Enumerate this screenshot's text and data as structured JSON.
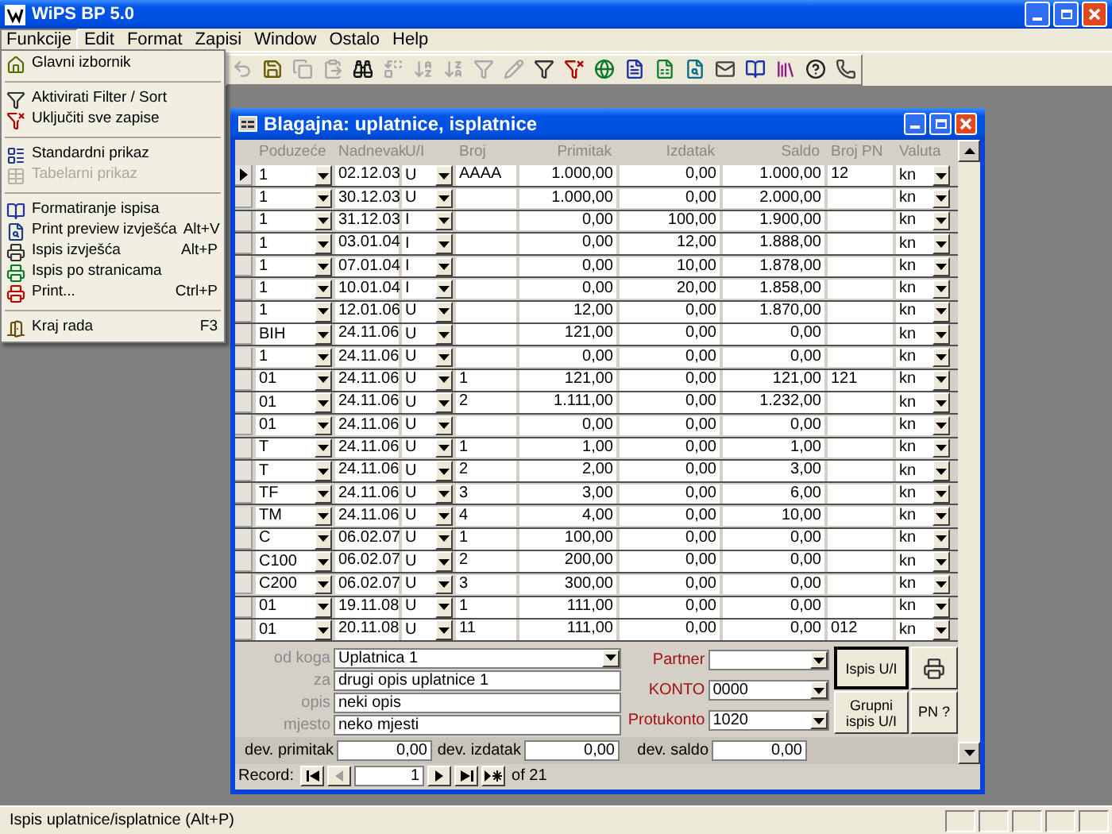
{
  "window": {
    "title": "WiPS BP 5.0"
  },
  "menu_bar": [
    {
      "label": "Funkcije",
      "selected": true
    },
    {
      "label": "Edit",
      "selected": false
    },
    {
      "label": "Format",
      "selected": false
    },
    {
      "label": "Zapisi",
      "selected": false
    },
    {
      "label": "Window",
      "selected": false
    },
    {
      "label": "Ostalo",
      "selected": false
    },
    {
      "label": "Help",
      "selected": false
    }
  ],
  "open_menu": [
    {
      "kind": "item",
      "label": "Glavni izbornik",
      "disabled": false
    },
    {
      "kind": "separator"
    },
    {
      "kind": "item",
      "label": "Aktivirati Filter / Sort",
      "disabled": false
    },
    {
      "kind": "item",
      "label": "Uključiti sve zapise",
      "disabled": false
    },
    {
      "kind": "separator"
    },
    {
      "kind": "item",
      "label": "Standardni prikaz",
      "disabled": false
    },
    {
      "kind": "item",
      "label": "Tabelarni prikaz",
      "disabled": true
    },
    {
      "kind": "separator"
    },
    {
      "kind": "item",
      "label": "Formatiranje ispisa",
      "disabled": false
    },
    {
      "kind": "item",
      "label": "Print preview izvješća",
      "shortcut": "Alt+V",
      "disabled": false
    },
    {
      "kind": "item",
      "label": "Ispis izvješća",
      "shortcut": "Alt+P",
      "disabled": false
    },
    {
      "kind": "item",
      "label": "Ispis po stranicama",
      "disabled": false
    },
    {
      "kind": "item",
      "label": "Print...",
      "shortcut": "Ctrl+P",
      "disabled": false
    },
    {
      "kind": "separator"
    },
    {
      "kind": "item",
      "label": "Kraj rada",
      "shortcut": "F3",
      "disabled": false
    }
  ],
  "toolbar": [
    {
      "disabled": true
    },
    {
      "disabled": false
    },
    {
      "disabled": true
    },
    {
      "disabled": true
    },
    {
      "disabled": false
    },
    {
      "disabled": true
    },
    {
      "disabled": true
    },
    {
      "disabled": true
    },
    {
      "disabled": true
    },
    {
      "disabled": true
    },
    {
      "disabled": false
    },
    {
      "disabled": false
    },
    {
      "disabled": false
    },
    {
      "disabled": false
    },
    {
      "disabled": false
    },
    {
      "disabled": false
    },
    {
      "disabled": false
    },
    {
      "disabled": false
    },
    {
      "disabled": false
    },
    {
      "disabled": false
    },
    {
      "disabled": false
    }
  ],
  "form_window": {
    "title": "Blagajna: uplatnice, isplatnice",
    "columns": [
      "Poduzeće",
      "Nadnevak",
      "U/I",
      "Broj",
      "Primitak",
      "Izdatak",
      "Saldo",
      "Broj PN",
      "Valuta"
    ],
    "rows": [
      {
        "selected": true,
        "cells": [
          "1",
          "02.12.03",
          "U",
          "AAAA",
          "1.000,00",
          "0,00",
          "1.000,00",
          "12",
          "kn"
        ]
      },
      {
        "selected": false,
        "cells": [
          "1",
          "30.12.03",
          "U",
          "",
          "1.000,00",
          "0,00",
          "2.000,00",
          "",
          "kn"
        ]
      },
      {
        "selected": false,
        "cells": [
          "1",
          "31.12.03",
          "I",
          "",
          "0,00",
          "100,00",
          "1.900,00",
          "",
          "kn"
        ]
      },
      {
        "selected": false,
        "cells": [
          "1",
          "03.01.04",
          "I",
          "",
          "0,00",
          "12,00",
          "1.888,00",
          "",
          "kn"
        ]
      },
      {
        "selected": false,
        "cells": [
          "1",
          "07.01.04",
          "I",
          "",
          "0,00",
          "10,00",
          "1.878,00",
          "",
          "kn"
        ]
      },
      {
        "selected": false,
        "cells": [
          "1",
          "10.01.04",
          "I",
          "",
          "0,00",
          "20,00",
          "1.858,00",
          "",
          "kn"
        ]
      },
      {
        "selected": false,
        "cells": [
          "1",
          "12.01.06",
          "U",
          "",
          "12,00",
          "0,00",
          "1.870,00",
          "",
          "kn"
        ]
      },
      {
        "selected": false,
        "cells": [
          "BIH",
          "24.11.06",
          "U",
          "",
          "121,00",
          "0,00",
          "0,00",
          "",
          "kn"
        ]
      },
      {
        "selected": false,
        "cells": [
          "1",
          "24.11.06",
          "U",
          "",
          "0,00",
          "0,00",
          "0,00",
          "",
          "kn"
        ]
      },
      {
        "selected": false,
        "cells": [
          "01",
          "24.11.06",
          "U",
          "1",
          "121,00",
          "0,00",
          "121,00",
          "121",
          "kn"
        ]
      },
      {
        "selected": false,
        "cells": [
          "01",
          "24.11.06",
          "U",
          "2",
          "1.111,00",
          "0,00",
          "1.232,00",
          "",
          "kn"
        ]
      },
      {
        "selected": false,
        "cells": [
          "01",
          "24.11.06",
          "U",
          "",
          "0,00",
          "0,00",
          "0,00",
          "",
          "kn"
        ]
      },
      {
        "selected": false,
        "cells": [
          "T",
          "24.11.06",
          "U",
          "1",
          "1,00",
          "0,00",
          "1,00",
          "",
          "kn"
        ]
      },
      {
        "selected": false,
        "cells": [
          "T",
          "24.11.06",
          "U",
          "2",
          "2,00",
          "0,00",
          "3,00",
          "",
          "kn"
        ]
      },
      {
        "selected": false,
        "cells": [
          "TF",
          "24.11.06",
          "U",
          "3",
          "3,00",
          "0,00",
          "6,00",
          "",
          "kn"
        ]
      },
      {
        "selected": false,
        "cells": [
          "TM",
          "24.11.06",
          "U",
          "4",
          "4,00",
          "0,00",
          "10,00",
          "",
          "kn"
        ]
      },
      {
        "selected": false,
        "cells": [
          "C",
          "06.02.07",
          "U",
          "1",
          "100,00",
          "0,00",
          "0,00",
          "",
          "kn"
        ]
      },
      {
        "selected": false,
        "cells": [
          "C100",
          "06.02.07",
          "U",
          "2",
          "200,00",
          "0,00",
          "0,00",
          "",
          "kn"
        ]
      },
      {
        "selected": false,
        "cells": [
          "C200",
          "06.02.07",
          "U",
          "3",
          "300,00",
          "0,00",
          "0,00",
          "",
          "kn"
        ]
      },
      {
        "selected": false,
        "cells": [
          "01",
          "19.11.08",
          "U",
          "1",
          "111,00",
          "0,00",
          "0,00",
          "",
          "kn"
        ]
      },
      {
        "selected": false,
        "cells": [
          "01",
          "20.11.08",
          "U",
          "11",
          "111,00",
          "0,00",
          "0,00",
          "012",
          "kn"
        ]
      }
    ],
    "details": [
      {
        "label": "od koga",
        "value": "Uplatnica 1",
        "kind": "combo"
      },
      {
        "label": "za",
        "value": "drugi opis uplatnice 1",
        "kind": "text"
      },
      {
        "label": "opis",
        "value": "neki opis",
        "kind": "text"
      },
      {
        "label": "mjesto",
        "value": "neko mjesti",
        "kind": "text"
      }
    ],
    "accounts": [
      {
        "label": "Partner"
      },
      {
        "label": "KONTO",
        "value": "0000"
      },
      {
        "label": "Protukonto",
        "value": "1020"
      }
    ],
    "buttons": {
      "print_row": "Ispis U/I",
      "group_print": "Grupni ispis U/I",
      "pn": "PN ?"
    },
    "totals": [
      {
        "label": "dev. primitak",
        "value": "0,00"
      },
      {
        "label": "dev. izdatak",
        "value": "0,00"
      },
      {
        "label": "dev. saldo",
        "value": "0,00"
      }
    ],
    "navigator": {
      "label": "Record:",
      "current": "1",
      "count": "of 21",
      "buttons": [
        {
          "disabled": false
        },
        {
          "disabled": true
        },
        {
          "disabled": false
        },
        {
          "disabled": false
        },
        {
          "disabled": false
        }
      ]
    }
  },
  "status_bar": {
    "text": "Ispis uplatnice/isplatnice (Alt+P)"
  }
}
